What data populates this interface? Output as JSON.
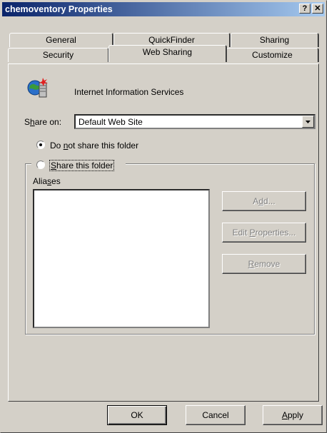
{
  "window": {
    "title": "chemoventory Properties",
    "help_glyph": "?",
    "close_glyph": "✕"
  },
  "tabs": {
    "row1": [
      "General",
      "QuickFinder",
      "Sharing"
    ],
    "row2": [
      "Security",
      "Web Sharing",
      "Customize"
    ],
    "active": "Web Sharing"
  },
  "panel": {
    "service_icon": "iis-globe-server-icon",
    "service_name": "Internet Information Services",
    "share_on_label_pre": "S",
    "share_on_label_u": "h",
    "share_on_label_post": "are on:",
    "share_on_value": "Default Web Site",
    "radio_no_share_pre": "Do ",
    "radio_no_share_u": "n",
    "radio_no_share_post": "ot share this folder",
    "radio_share_u": "S",
    "radio_share_post": "hare this folder",
    "aliases_pre": "Alia",
    "aliases_u": "s",
    "aliases_post": "es",
    "add_pre": "A",
    "add_u": "d",
    "add_post": "d...",
    "edit_pre": "Edit ",
    "edit_u": "P",
    "edit_post": "roperties...",
    "remove_u": "R",
    "remove_post": "emove"
  },
  "footer": {
    "ok": "OK",
    "cancel": "Cancel",
    "apply_u": "A",
    "apply_post": "pply"
  }
}
